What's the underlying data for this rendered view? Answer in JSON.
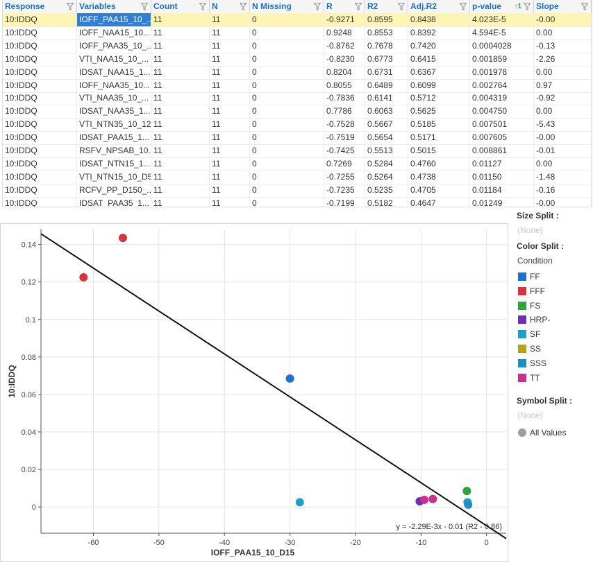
{
  "table": {
    "columns": [
      {
        "key": "response",
        "label": "Response"
      },
      {
        "key": "variables",
        "label": "Variables"
      },
      {
        "key": "count",
        "label": "Count"
      },
      {
        "key": "n",
        "label": "N"
      },
      {
        "key": "n_missing",
        "label": "N Missing"
      },
      {
        "key": "r",
        "label": "R"
      },
      {
        "key": "r2",
        "label": "R2"
      },
      {
        "key": "adj_r2",
        "label": "Adj.R2"
      },
      {
        "key": "p_value",
        "label": "p-value"
      },
      {
        "key": "slope",
        "label": "Slope"
      }
    ],
    "sort_badge": "1",
    "rows": [
      [
        "10:IDDQ",
        "IOFF_PAA15_10_...",
        "11",
        "11",
        "0",
        "-0.9271",
        "0.8595",
        "0.8438",
        "4.023E-5",
        "-0.00"
      ],
      [
        "10:IDDQ",
        "IOFF_NAA15_10...",
        "11",
        "11",
        "0",
        "0.9248",
        "0.8553",
        "0.8392",
        "4.594E-5",
        "0.00"
      ],
      [
        "10:IDDQ",
        "IOFF_PAA35_10_...",
        "11",
        "11",
        "0",
        "-0.8762",
        "0.7678",
        "0.7420",
        "0.0004028",
        "-0.13"
      ],
      [
        "10:IDDQ",
        "VTI_NAA15_10_...",
        "11",
        "11",
        "0",
        "-0.8230",
        "0.6773",
        "0.6415",
        "0.001859",
        "-2.26"
      ],
      [
        "10:IDDQ",
        "IDSAT_NAA15_1...",
        "11",
        "11",
        "0",
        "0.8204",
        "0.6731",
        "0.6367",
        "0.001978",
        "0.00"
      ],
      [
        "10:IDDQ",
        "IOFF_NAA35_10...",
        "11",
        "11",
        "0",
        "0.8055",
        "0.6489",
        "0.6099",
        "0.002764",
        "0.97"
      ],
      [
        "10:IDDQ",
        "VTI_NAA35_10_...",
        "11",
        "11",
        "0",
        "-0.7836",
        "0.6141",
        "0.5712",
        "0.004319",
        "-0.92"
      ],
      [
        "10:IDDQ",
        "IDSAT_NAA35_1...",
        "11",
        "11",
        "0",
        "0.7786",
        "0.6063",
        "0.5625",
        "0.004750",
        "0.00"
      ],
      [
        "10:IDDQ",
        "VTI_NTN35_10_12",
        "11",
        "11",
        "0",
        "-0.7528",
        "0.5667",
        "0.5185",
        "0.007501",
        "-5.43"
      ],
      [
        "10:IDDQ",
        "IDSAT_PAA15_1...",
        "11",
        "11",
        "0",
        "-0.7519",
        "0.5654",
        "0.5171",
        "0.007605",
        "-0.00"
      ],
      [
        "10:IDDQ",
        "RSFV_NPSAB_10...",
        "11",
        "11",
        "0",
        "-0.7425",
        "0.5513",
        "0.5015",
        "0.008861",
        "-0.01"
      ],
      [
        "10:IDDQ",
        "IDSAT_NTN15_1...",
        "11",
        "11",
        "0",
        "0.7269",
        "0.5284",
        "0.4760",
        "0.01127",
        "0.00"
      ],
      [
        "10:IDDQ",
        "VTI_NTN15_10_D5",
        "11",
        "11",
        "0",
        "-0.7255",
        "0.5264",
        "0.4738",
        "0.01150",
        "-1.48"
      ],
      [
        "10:IDDQ",
        "RCFV_PP_D150_...",
        "11",
        "11",
        "0",
        "-0.7235",
        "0.5235",
        "0.4705",
        "0.01184",
        "-0.16"
      ],
      [
        "10:IDDQ",
        "IDSAT_PAA35_1...",
        "11",
        "11",
        "0",
        "-0.7199",
        "0.5182",
        "0.4647",
        "0.01249",
        "-0.00"
      ]
    ]
  },
  "plot": {
    "xlabel": "IOFF_PAA15_10_D15",
    "ylabel": "10:IDDQ",
    "fit_label": "y = -2.29E-3x - 0.01 (R2 - 0.86)"
  },
  "chart_data": {
    "type": "scatter",
    "xlabel": "IOFF_PAA15_10_D15",
    "ylabel": "10:IDDQ",
    "xlim": [
      -68,
      3
    ],
    "ylim": [
      -0.014,
      0.148
    ],
    "x_ticks": [
      -60,
      -50,
      -40,
      -30,
      -20,
      -10,
      0
    ],
    "y_ticks": [
      0,
      0.02,
      0.04,
      0.06,
      0.08,
      0.1,
      0.12,
      0.14
    ],
    "y_tick_labels": [
      "0",
      "0.02",
      "0.04",
      "0.06",
      "0.08",
      "0.1",
      "0.12",
      "0.14"
    ],
    "grid": true,
    "fit": {
      "slope": -0.00229,
      "intercept": -0.01,
      "r2": 0.86
    },
    "points": [
      {
        "x": -61.5,
        "y": 0.1225,
        "group": "FFF"
      },
      {
        "x": -55.5,
        "y": 0.1435,
        "group": "FFF"
      },
      {
        "x": -30.0,
        "y": 0.0685,
        "group": "FF"
      },
      {
        "x": -28.5,
        "y": 0.0025,
        "group": "SF"
      },
      {
        "x": -10.2,
        "y": 0.003,
        "group": "HRP-"
      },
      {
        "x": -9.5,
        "y": 0.0038,
        "group": "TT"
      },
      {
        "x": -8.2,
        "y": 0.0042,
        "group": "TT"
      },
      {
        "x": -3.0,
        "y": 0.0085,
        "group": "FS"
      },
      {
        "x": -2.9,
        "y": 0.0025,
        "group": "SF"
      },
      {
        "x": -2.8,
        "y": 0.0012,
        "group": "SSS"
      }
    ]
  },
  "side_panel": {
    "size_split": {
      "title": "Size Split :",
      "value": "(None)"
    },
    "color_split": {
      "title": "Color Split :",
      "variable": "Condition",
      "items": [
        {
          "label": "FF",
          "color": "#1f6fd6"
        },
        {
          "label": "FFF",
          "color": "#d7343f"
        },
        {
          "label": "FS",
          "color": "#2ea43b"
        },
        {
          "label": "HRP-",
          "color": "#6f2fb2"
        },
        {
          "label": "SF",
          "color": "#1f9ec9"
        },
        {
          "label": "SS",
          "color": "#b5a416"
        },
        {
          "label": "SSS",
          "color": "#1e8fc2"
        },
        {
          "label": "TT",
          "color": "#c9308f"
        }
      ]
    },
    "symbol_split": {
      "title": "Symbol Split :",
      "value": "(None)",
      "all_label": "All Values"
    }
  },
  "icons": {
    "filter": "filter-icon",
    "sort": "sort-ascending-icon",
    "symbol": "circle-symbol-icon"
  }
}
